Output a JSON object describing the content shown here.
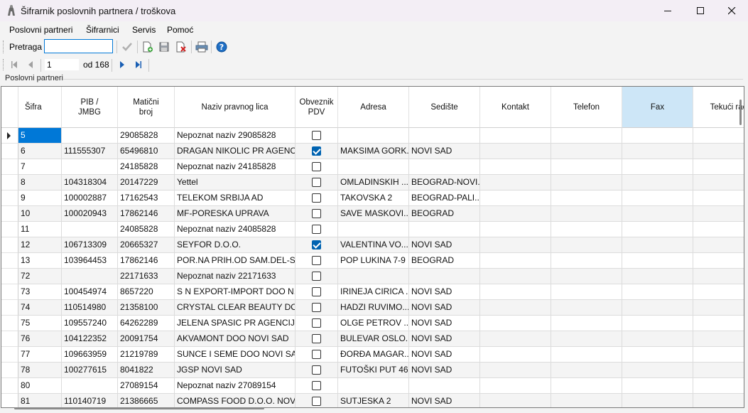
{
  "window": {
    "title": "Šifrarnik poslovnih partnera / troškova",
    "minimize_icon": "minimize-icon",
    "maximize_icon": "maximize-icon",
    "close_icon": "close-icon"
  },
  "menu": [
    "Poslovni partneri",
    "Šifrarnici",
    "Servis",
    "Pomoć"
  ],
  "toolbar": {
    "search_label": "Pretraga",
    "search_value": "",
    "icons": [
      "confirm-icon",
      "new-record-icon",
      "save-icon",
      "delete-icon",
      "print-icon",
      "help-icon"
    ]
  },
  "pager": {
    "current_page": "1",
    "of_label": "od 168",
    "icons": [
      "first-page-icon",
      "previous-page-icon",
      "next-page-icon",
      "last-page-icon"
    ]
  },
  "group_label": "Poslovni partneri",
  "grid": {
    "columns": [
      "Šifra",
      "PIB /\nJMBG",
      "Matični\nbroj",
      "Naziv pravnog lica",
      "Obveznik\nPDV",
      "Adresa",
      "Sedište",
      "Kontakt",
      "Telefon",
      "Fax",
      "Tekući rač"
    ],
    "selected_column": 9,
    "selected_row": 0,
    "rows": [
      {
        "sifra": "5",
        "pib": "",
        "mb": "29085828",
        "naziv": "Nepoznat naziv 29085828",
        "pdv": false,
        "adresa": "",
        "sediste": ""
      },
      {
        "sifra": "6",
        "pib": "111555307",
        "mb": "65496810",
        "naziv": "DRAGAN NIKOLIC PR AGENCI...",
        "pdv": true,
        "adresa": "MAKSIMA GORK...",
        "sediste": "NOVI SAD"
      },
      {
        "sifra": "7",
        "pib": "",
        "mb": "24185828",
        "naziv": "Nepoznat naziv 24185828",
        "pdv": false,
        "adresa": "",
        "sediste": ""
      },
      {
        "sifra": "8",
        "pib": "104318304",
        "mb": "20147229",
        "naziv": "Yettel",
        "pdv": false,
        "adresa": "OMLADINSKIH ...",
        "sediste": "BEOGRAD-NOVI..."
      },
      {
        "sifra": "9",
        "pib": "100002887",
        "mb": "17162543",
        "naziv": "TELEKOM SRBIJA AD",
        "pdv": false,
        "adresa": "TAKOVSKA 2",
        "sediste": "BEOGRAD-PALI..."
      },
      {
        "sifra": "10",
        "pib": "100020943",
        "mb": "17862146",
        "naziv": "MF-PORESKA UPRAVA",
        "pdv": false,
        "adresa": "SAVE MASKOVI...",
        "sediste": "BEOGRAD"
      },
      {
        "sifra": "11",
        "pib": "",
        "mb": "24085828",
        "naziv": "Nepoznat naziv 24085828",
        "pdv": false,
        "adresa": "",
        "sediste": ""
      },
      {
        "sifra": "12",
        "pib": "106713309",
        "mb": "20665327",
        "naziv": "SEYFOR D.O.O.",
        "pdv": true,
        "adresa": "VALENTINA VO...",
        "sediste": "NOVI SAD"
      },
      {
        "sifra": "13",
        "pib": "103964453",
        "mb": "17862146",
        "naziv": "POR.NA PRIH.OD SAM.DEL-S...",
        "pdv": false,
        "adresa": "POP LUKINA 7-9",
        "sediste": "BEOGRAD"
      },
      {
        "sifra": "72",
        "pib": "",
        "mb": "22171633",
        "naziv": "Nepoznat naziv 22171633",
        "pdv": false,
        "adresa": "",
        "sediste": ""
      },
      {
        "sifra": "73",
        "pib": "100454974",
        "mb": "8657220",
        "naziv": "S  N EXPORT-IMPORT DOO N...",
        "pdv": false,
        "adresa": "IRINEJA CIRICA ...",
        "sediste": "NOVI SAD"
      },
      {
        "sifra": "74",
        "pib": "110514980",
        "mb": "21358100",
        "naziv": "CRYSTAL CLEAR BEAUTY DO...",
        "pdv": false,
        "adresa": "HADZI RUVIMO...",
        "sediste": "NOVI SAD"
      },
      {
        "sifra": "75",
        "pib": "109557240",
        "mb": "64262289",
        "naziv": "JELENA SPASIC PR AGENCIJ...",
        "pdv": false,
        "adresa": "OLGE PETROV ...",
        "sediste": "NOVI SAD"
      },
      {
        "sifra": "76",
        "pib": "104122352",
        "mb": "20091754",
        "naziv": "AKVAMONT DOO NOVI SAD",
        "pdv": false,
        "adresa": "BULEVAR OSLO...",
        "sediste": "NOVI SAD"
      },
      {
        "sifra": "77",
        "pib": "109663959",
        "mb": "21219789",
        "naziv": "SUNCE I SEME DOO NOVI SAD",
        "pdv": false,
        "adresa": "ĐORĐA MAGAR...",
        "sediste": "NOVI SAD"
      },
      {
        "sifra": "78",
        "pib": "100277615",
        "mb": "8041822",
        "naziv": "JGSP NOVI SAD",
        "pdv": false,
        "adresa": "FUTOŠKI PUT 46",
        "sediste": "NOVI SAD"
      },
      {
        "sifra": "80",
        "pib": "",
        "mb": "27089154",
        "naziv": "Nepoznat naziv 27089154",
        "pdv": false,
        "adresa": "",
        "sediste": ""
      },
      {
        "sifra": "81",
        "pib": "110140719",
        "mb": "21386665",
        "naziv": "COMPASS FOOD D.O.O. NOVI...",
        "pdv": false,
        "adresa": "SUTJESKA 2",
        "sediste": "NOVI SAD"
      }
    ]
  }
}
